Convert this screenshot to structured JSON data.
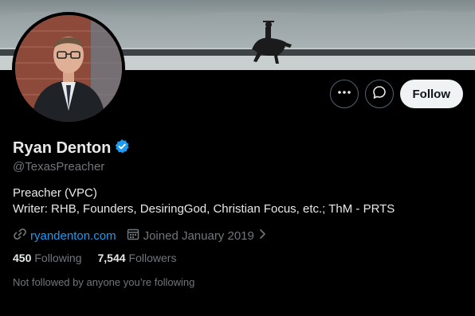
{
  "profile": {
    "name": "Ryan Denton",
    "handle": "@TexasPreacher",
    "verified": true,
    "bio_line1": "Preacher (VPC)",
    "bio_line2": "Writer: RHB, Founders, DesiringGod, Christian Focus, etc.; ThM - PRTS",
    "website": "ryandenton.com",
    "joined": "Joined January 2019",
    "following_count": "450",
    "following_label": "Following",
    "followers_count": "7,544",
    "followers_label": "Followers",
    "not_followed": "Not followed by anyone you’re following"
  },
  "actions": {
    "more_icon": "more-icon",
    "message_icon": "message-icon",
    "follow_label": "Follow"
  },
  "colors": {
    "background": "#000000",
    "accent": "#1d9bf0",
    "secondary_text": "#71767b",
    "verified": "#1d9bf0"
  }
}
